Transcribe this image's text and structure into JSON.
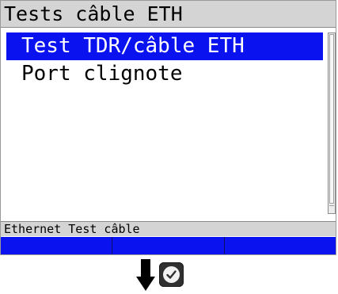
{
  "screen": {
    "title": "Tests câble ETH",
    "menu": {
      "items": [
        {
          "label": "Test TDR/câble ETH",
          "selected": true
        },
        {
          "label": "Port clignote",
          "selected": false
        }
      ]
    },
    "status": "Ethernet Test câble",
    "softkeys": [
      "",
      "",
      ""
    ]
  },
  "below_screen": {
    "arrow_icon": "arrow-down-icon",
    "ok_icon": "checkmark-circle-icon"
  },
  "colors": {
    "selection": "#0a12f0",
    "softkey_bar": "#0a12f0",
    "title_bar": "#d4d4d4"
  }
}
